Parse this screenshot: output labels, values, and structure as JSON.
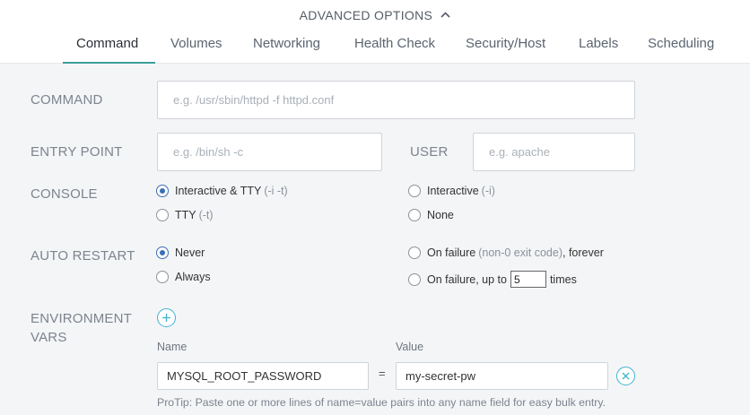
{
  "header": {
    "advanced_label": "ADVANCED OPTIONS",
    "caret_icon": "chevron-up-icon"
  },
  "tabs": [
    {
      "label": "Command",
      "active": true
    },
    {
      "label": "Volumes",
      "active": false
    },
    {
      "label": "Networking",
      "active": false
    },
    {
      "label": "Health Check",
      "active": false
    },
    {
      "label": "Security/Host",
      "active": false
    },
    {
      "label": "Labels",
      "active": false
    },
    {
      "label": "Scheduling",
      "active": false
    }
  ],
  "command": {
    "label": "COMMAND",
    "placeholder": "e.g. /usr/sbin/httpd -f httpd.conf",
    "value": ""
  },
  "entry_point": {
    "label": "ENTRY POINT",
    "placeholder": "e.g. /bin/sh -c",
    "value": ""
  },
  "user": {
    "label": "USER",
    "placeholder": "e.g. apache",
    "value": ""
  },
  "console": {
    "label": "CONSOLE",
    "options": [
      {
        "label": "Interactive & TTY",
        "hint": "(-i -t)",
        "selected": true
      },
      {
        "label": "Interactive",
        "hint": "(-i)",
        "selected": false
      },
      {
        "label": "TTY",
        "hint": "(-t)",
        "selected": false
      },
      {
        "label": "None",
        "hint": "",
        "selected": false
      }
    ]
  },
  "auto_restart": {
    "label": "AUTO RESTART",
    "never": "Never",
    "always": "Always",
    "on_failure_forever": {
      "label": "On failure",
      "hint": "(non-0 exit code)",
      "suffix": ", forever"
    },
    "on_failure_upto": {
      "label": "On failure, up to",
      "count": "5",
      "suffix": "times"
    },
    "selected": "never"
  },
  "env": {
    "label_line1": "ENVIRONMENT",
    "label_line2": "VARS",
    "add_icon": "plus-icon",
    "name_header": "Name",
    "value_header": "Value",
    "rows": [
      {
        "name": "MYSQL_ROOT_PASSWORD",
        "equals": "=",
        "value": "my-secret-pw"
      }
    ],
    "remove_icon": "close-icon",
    "protip": "ProTip: Paste one or more lines of name=value pairs into any name field for easy bulk entry."
  },
  "colors": {
    "accent": "#3a9e9a",
    "radio": "#3b6fb5",
    "action": "#3fb4cf"
  }
}
